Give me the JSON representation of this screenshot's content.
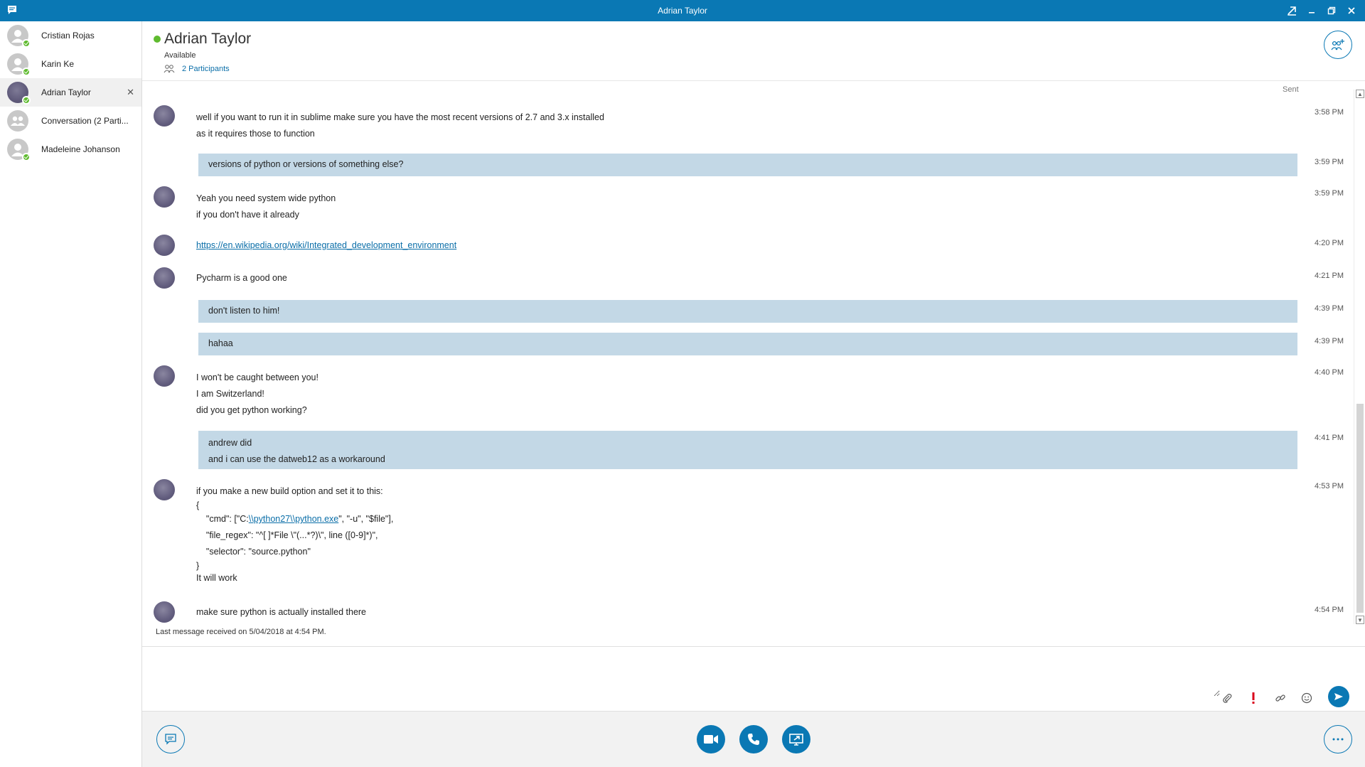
{
  "window": {
    "title": "Adrian Taylor"
  },
  "sidebar": {
    "items": [
      {
        "name": "Cristian Rojas"
      },
      {
        "name": "Karin Ke"
      },
      {
        "name": "Adrian Taylor"
      },
      {
        "name": "Conversation (2 Parti..."
      },
      {
        "name": "Madeleine Johanson"
      }
    ],
    "close_glyph": "✕"
  },
  "header": {
    "name": "Adrian Taylor",
    "status": "Available",
    "participants": "2 Participants"
  },
  "conversation": {
    "sent_label": "Sent",
    "messages": [
      {
        "lines": [
          "well if you want to run it in sublime make sure you have the most recent versions of 2.7 and 3.x installed",
          "as it requires those to function"
        ],
        "time": "3:58 PM"
      },
      {
        "lines": [
          "versions of python or versions of something else?"
        ],
        "time": "3:59 PM"
      },
      {
        "lines": [
          "Yeah you need system wide python",
          "if you don't have it already"
        ],
        "time": "3:59 PM"
      },
      {
        "link": "https://en.wikipedia.org/wiki/Integrated_development_environment",
        "time": "4:20 PM"
      },
      {
        "lines": [
          "Pycharm is a good one"
        ],
        "time": "4:21 PM"
      },
      {
        "lines": [
          "don't listen to him!"
        ],
        "time": "4:39 PM"
      },
      {
        "lines": [
          "hahaa"
        ],
        "time": "4:39 PM"
      },
      {
        "lines": [
          "I won't be caught between you!",
          "I am Switzerland!",
          "did you get python working?"
        ],
        "time": "4:40 PM"
      },
      {
        "lines": [
          "andrew did",
          "and i can use the datweb12 as a workaround"
        ],
        "time": "4:41 PM"
      },
      {
        "lines": [
          "if you make a new build option and set it to this:",
          "{"
        ],
        "cmd_prefix": "    \"cmd\": [\"C:",
        "cmd_link": "\\\\python27\\\\python.exe",
        "cmd_suffix": "\", \"-u\", \"$file\"],",
        "code": [
          "    \"file_regex\": \"^[ ]*File \\\"(...*?)\\\", line ([0-9]*)\",",
          "    \"selector\": \"source.python\""
        ],
        "tail": [
          "}",
          "It will work"
        ],
        "time": "4:53 PM"
      },
      {
        "lines": [
          "make sure python is actually installed there"
        ],
        "time": "4:54 PM"
      }
    ],
    "last_received": "Last message received on 5/04/2018 at 4:54 PM."
  },
  "composer": {
    "value": "",
    "placeholder": ""
  },
  "icons": {
    "attach": "paperclip-icon",
    "importance": "exclamation-icon",
    "link": "link-icon",
    "emoji": "smiley-icon",
    "send": "send-icon",
    "im": "chat-icon",
    "video": "video-icon",
    "call": "phone-icon",
    "present": "present-screen-icon",
    "more": "more-options-icon"
  },
  "colors": {
    "accent": "#0a78b4",
    "presence_available": "#5fbb2f",
    "outgoing_bubble": "#c3d8e6",
    "importance_red": "#d9001b"
  }
}
